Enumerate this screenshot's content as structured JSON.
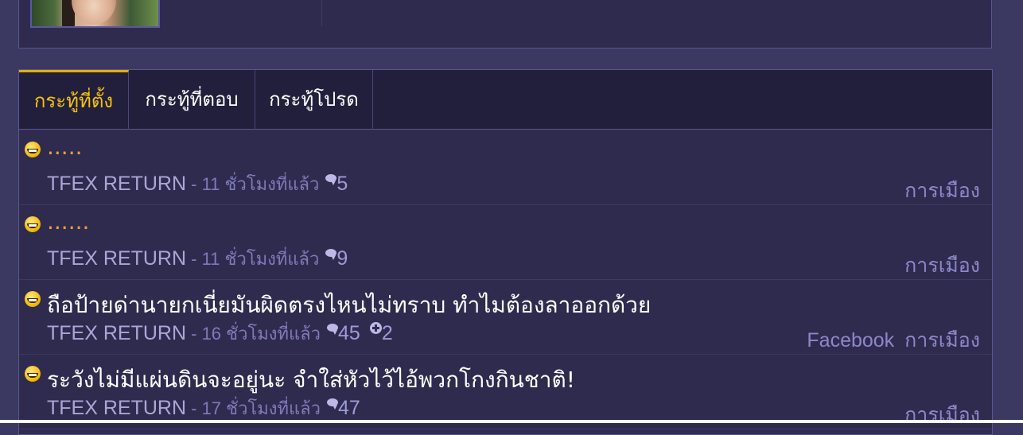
{
  "tabs": [
    {
      "label": "กระทู้ที่ตั้ง",
      "active": true
    },
    {
      "label": "กระทู้ที่ตอบ",
      "active": false
    },
    {
      "label": "กระทู้โปรด",
      "active": false
    }
  ],
  "topics": [
    {
      "title": ".....",
      "author": "TFEX RETURN",
      "time": "11 ชั่วโมงที่แล้ว",
      "comments": "5",
      "plus": "",
      "tags": [
        "การเมือง"
      ]
    },
    {
      "title": "......",
      "author": "TFEX RETURN",
      "time": "11 ชั่วโมงที่แล้ว",
      "comments": "9",
      "plus": "",
      "tags": [
        "การเมือง"
      ]
    },
    {
      "title": "ถือป้ายด่านายกเนี่ยมันผิดตรงไหนไม่ทราบ ทำไมต้องลาออกด้วย",
      "author": "TFEX RETURN",
      "time": "16 ชั่วโมงที่แล้ว",
      "comments": "45",
      "plus": "2",
      "tags": [
        "Facebook",
        "การเมือง"
      ]
    },
    {
      "title": "ระวังไม่มีแผ่นดินจะอยู่นะ จำใส่หัวไว้ไอ้พวกโกงกินชาติ!",
      "author": "TFEX RETURN",
      "time": "17 ชั่วโมงที่แล้ว",
      "comments": "47",
      "plus": "",
      "tags": [
        "การเมือง"
      ]
    }
  ],
  "separator": " - "
}
